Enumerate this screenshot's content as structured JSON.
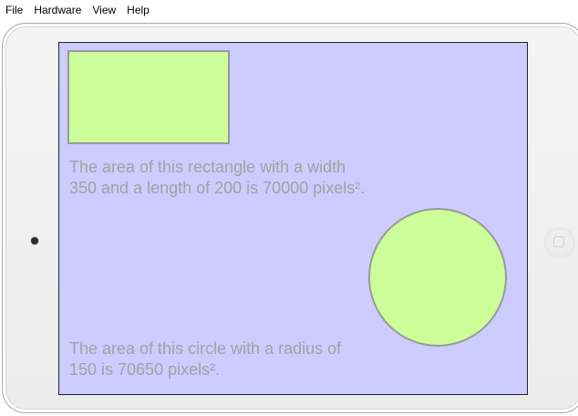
{
  "menu": {
    "items": [
      "File",
      "Hardware",
      "View",
      "Help"
    ]
  },
  "screen": {
    "background_color": "#ccccff",
    "shape_fill": "#ccff99",
    "shape_border": "#999999",
    "rect_caption_line1": "The area of this rectangle with a width",
    "rect_caption_line2": "350 and a length of 200 is 70000 pixels².",
    "circle_caption_line1": "The area of this circle with a radius of",
    "circle_caption_line2": "150 is 70650 pixels²."
  }
}
